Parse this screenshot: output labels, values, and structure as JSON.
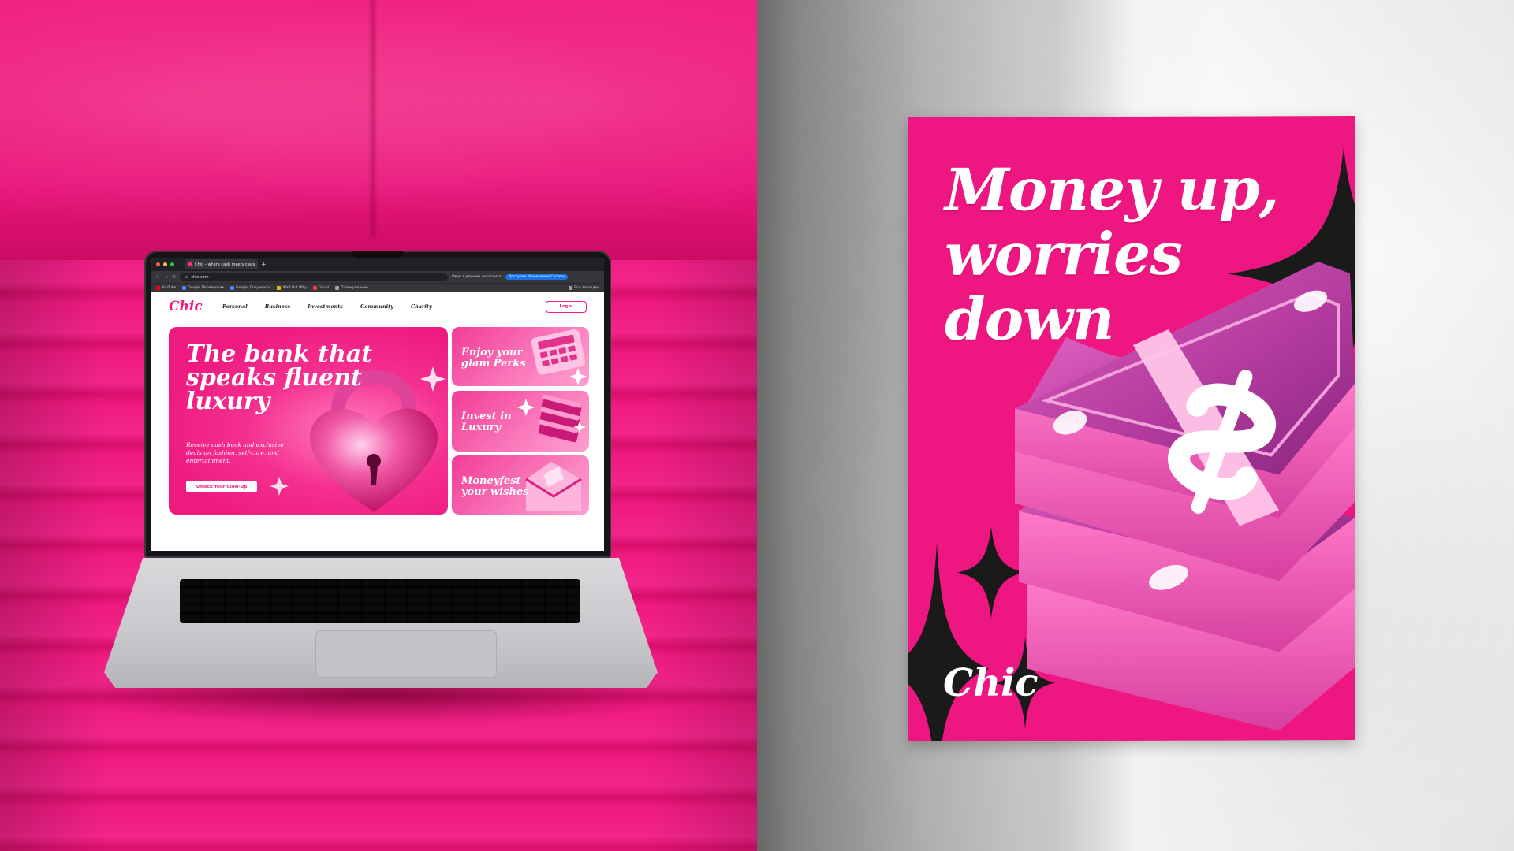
{
  "browser": {
    "tab_title": "Chic – where cash meets class",
    "tab_close": "×",
    "new_tab": "+",
    "url": "chic.com",
    "incognito_label": "Окно в режиме инкогнито",
    "update_label": "Доступно обновление Chrome",
    "bookmarks": [
      {
        "label": "YouTube",
        "color": "#ff0000"
      },
      {
        "label": "Google Переводчик",
        "color": "#4285f4"
      },
      {
        "label": "Google Документы",
        "color": "#4285f4"
      },
      {
        "label": "Wait But Why",
        "color": "#f4b400"
      },
      {
        "label": "Gmail",
        "color": "#ea4335"
      },
      {
        "label": "Планирование",
        "color": "#9e9e9e"
      }
    ],
    "all_bookmarks": "Все закладки"
  },
  "site": {
    "logo": "Chic",
    "nav": [
      "Personal",
      "Business",
      "Investments",
      "Community",
      "Charity"
    ],
    "login": "Login",
    "hero": {
      "title": "The bank that speaks fluent luxury",
      "description": "Receive cash back and exclusive deals on fashion, self-care, and entertainment.",
      "cta": "Unlock Your Glow-Up"
    },
    "cards": [
      {
        "label": "Enjoy your glam Perks",
        "icon": "calculator-icon"
      },
      {
        "label": "Invest in Luxury",
        "icon": "money-stack-icon"
      },
      {
        "label": "Moneyfest your wishes",
        "icon": "envelope-icon"
      }
    ]
  },
  "poster": {
    "headline_lines": [
      "Money up,",
      "worries",
      "down"
    ],
    "brand": "Chic",
    "icon": "dollar-stack-icon"
  },
  "colors": {
    "brand_pink": "#ee1781",
    "accent_pink": "#f01a82",
    "sparkle_dark": "#1a1a1a"
  }
}
